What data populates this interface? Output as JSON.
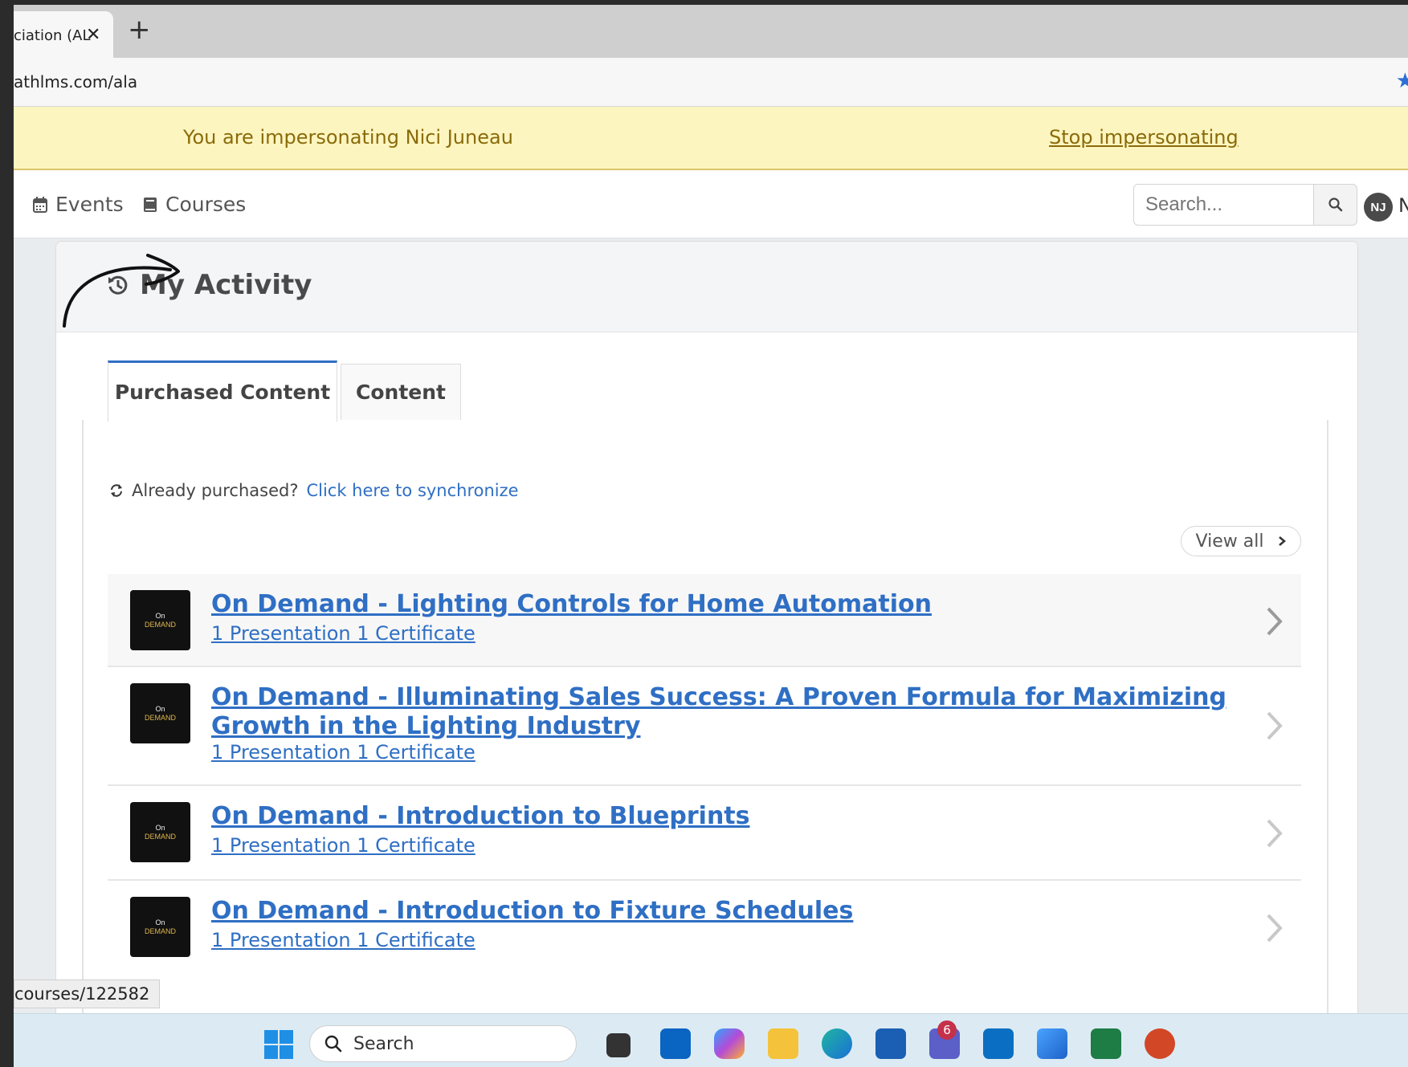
{
  "browser": {
    "tab_title": "ciation (AL",
    "tab_close": "✕",
    "new_tab": "+",
    "url": "athlms.com/ala",
    "status_url": "courses/122582"
  },
  "banner": {
    "message": "You are impersonating Nici Juneau",
    "stop_link": "Stop impersonating"
  },
  "nav": {
    "events": "Events",
    "courses": "Courses",
    "search_placeholder": "Search...",
    "avatar_initials": "NJ",
    "avatar_name": "N"
  },
  "activity": {
    "title": "My Activity",
    "tabs": [
      {
        "label": "Purchased Content",
        "active": true
      },
      {
        "label": "Content",
        "active": false
      }
    ],
    "sync_text": "Already purchased?",
    "sync_link": "Click here to synchronize",
    "view_all": "View all",
    "thumb_top": "On",
    "thumb_bottom": "DEMAND",
    "items": [
      {
        "title": "On Demand - Lighting Controls for Home Automation",
        "subtitle": "1 Presentation 1 Certificate"
      },
      {
        "title": "On Demand - Illuminating Sales Success: A Proven Formula for Maximizing Growth in the Lighting Industry",
        "subtitle": "1 Presentation 1 Certificate"
      },
      {
        "title": "On Demand - Introduction to Blueprints",
        "subtitle": "1 Presentation 1 Certificate"
      },
      {
        "title": "On Demand - Introduction to Fixture Schedules",
        "subtitle": "1 Presentation 1 Certificate"
      }
    ]
  },
  "taskbar": {
    "search_label": "Search",
    "teams_badge": "6",
    "apps": [
      "file-explorer-icon",
      "outlook-icon",
      "copilot-icon",
      "folder-icon",
      "edge-icon",
      "store-icon",
      "teams-icon",
      "dell-icon",
      "photos-icon",
      "excel-icon",
      "powerpoint-icon"
    ]
  },
  "colors": {
    "link": "#2f6fc4",
    "banner_bg": "#fdf5c0",
    "banner_text": "#8a6b0a",
    "tab_accent": "#2f6fc4"
  }
}
